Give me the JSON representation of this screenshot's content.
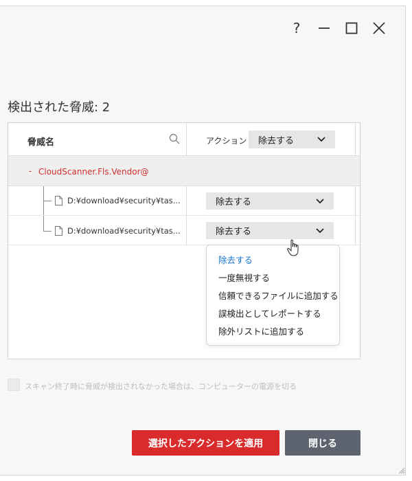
{
  "window": {
    "controls": {
      "help": "?"
    }
  },
  "title": "検出された脅威: 2",
  "table": {
    "col_threat": "脅威名",
    "col_action": "アクション",
    "header_action_value": "除去する",
    "group": {
      "toggle": "-",
      "label": "CloudScanner.Fls.Vendor@"
    },
    "rows": [
      {
        "path": "D:¥download¥security¥tas...",
        "action": "除去する"
      },
      {
        "path": "D:¥download¥security¥tas...",
        "action": "除去する"
      }
    ]
  },
  "menu": {
    "items": [
      "除去する",
      "一度無視する",
      "信頼できるファイルに追加する",
      "誤検出としてレポートする",
      "除外リストに追加する"
    ],
    "selected_index": 0
  },
  "shutdown_option": {
    "label": "スキャン終了時に脅威が検出されなかった場合は、コンピューターの電源を切る",
    "checked": false
  },
  "buttons": {
    "apply": "選択したアクションを適用",
    "close": "閉じる"
  },
  "colors": {
    "accent_red": "#d92b2b",
    "threat_red": "#d32f2f",
    "close_gray": "#5d6470",
    "selected_blue": "#1976d2"
  },
  "icons": [
    "help-icon",
    "minimize-icon",
    "maximize-icon",
    "close-icon",
    "search-icon",
    "chevron-down-icon",
    "file-icon",
    "hand-cursor-icon",
    "resize-grip-icon"
  ]
}
